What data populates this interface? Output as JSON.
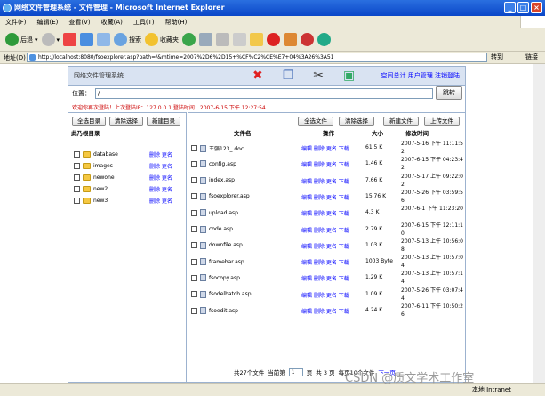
{
  "window": {
    "title": "网络文件管理系统 - 文件管理 - Microsoft Internet Explorer"
  },
  "menu": [
    "文件(F)",
    "编辑(E)",
    "查看(V)",
    "收藏(A)",
    "工具(T)",
    "帮助(H)"
  ],
  "toolbar": {
    "back": "后退",
    "search": "搜索",
    "favorites": "收藏夹"
  },
  "address": {
    "label": "地址(D)",
    "url": "http://localhost:8080/fsoexplorer.asp?path=/&mtime=2007%2D6%2D15+%CF%C2%CE%E7+04%3A26%3A51",
    "go": "转到",
    "links": "链接"
  },
  "app": {
    "title": "网络文件管理系统",
    "toplinks": "空间总计 用户管理 注销登陆",
    "location_label": "位置：",
    "location_value": "/",
    "jump": "跳转",
    "warn": "欢迎你再次登陆！上次登陆IP：127.0.0.1  登陆时间：2007-6-15 下午 12:27:54"
  },
  "left": {
    "buttons": [
      "全选目录",
      "清除选择",
      "新建目录"
    ],
    "header": "此乃根目录",
    "folders": [
      {
        "name": "database",
        "ops": "删除 更名"
      },
      {
        "name": "images",
        "ops": "删除 更名"
      },
      {
        "name": "newone",
        "ops": "删除 更名"
      },
      {
        "name": "new2",
        "ops": "删除 更名"
      },
      {
        "name": "new3",
        "ops": "删除 更名"
      }
    ]
  },
  "right": {
    "buttons": [
      "全选文件",
      "清除选择",
      "新建文件",
      "上传文件"
    ],
    "headers": [
      "文件名",
      "操作",
      "大小",
      "修改时间"
    ],
    "files": [
      {
        "name": "王强123_.doc",
        "ops": "编辑 删除 更名 下载",
        "size": "61.5 K",
        "time": "2007-5-16 下午 11:11:52"
      },
      {
        "name": "config.asp",
        "ops": "编辑 删除 更名 下载",
        "size": "1.46 K",
        "time": "2007-6-15 下午 04:23:42"
      },
      {
        "name": "index.asp",
        "ops": "编辑 删除 更名 下载",
        "size": "7.66 K",
        "time": "2007-5-17 上午 09:22:02"
      },
      {
        "name": "fsoexplorer.asp",
        "ops": "编辑 删除 更名 下载",
        "size": "15.76 K",
        "time": "2007-5-26 下午 03:59:56"
      },
      {
        "name": "upload.asp",
        "ops": "编辑 删除 更名 下载",
        "size": "4.3 K",
        "time": "2007-6-1 下午 11:23:20"
      },
      {
        "name": "code.asp",
        "ops": "编辑 删除 更名 下载",
        "size": "2.79 K",
        "time": "2007-6-15 下午 12:11:10"
      },
      {
        "name": "downfile.asp",
        "ops": "编辑 删除 更名 下载",
        "size": "1.03 K",
        "time": "2007-5-13 上午 10:56:08"
      },
      {
        "name": "framebar.asp",
        "ops": "编辑 删除 更名 下载",
        "size": "1003 Byte",
        "time": "2007-5-13 上午 10:57:04"
      },
      {
        "name": "fsocopy.asp",
        "ops": "编辑 删除 更名 下载",
        "size": "1.29 K",
        "time": "2007-5-13 上午 10:57:14"
      },
      {
        "name": "fsodelbatch.asp",
        "ops": "编辑 删除 更名 下载",
        "size": "1.09 K",
        "time": "2007-5-26 下午 03:07:44"
      },
      {
        "name": "fsoedit.asp",
        "ops": "编辑 删除 更名 下载",
        "size": "4.24 K",
        "time": "2007-6-11 下午 10:50:26"
      }
    ],
    "pager": {
      "total": "共27个文件",
      "current_label": "当前第",
      "page": "1",
      "page_suffix": "页",
      "total_pages": "共 3 页",
      "per_page": "每页10个文件",
      "next": "下一页"
    }
  },
  "status": {
    "zone": "本地 Intranet"
  },
  "watermark": "CSDN @质文学术工作室"
}
